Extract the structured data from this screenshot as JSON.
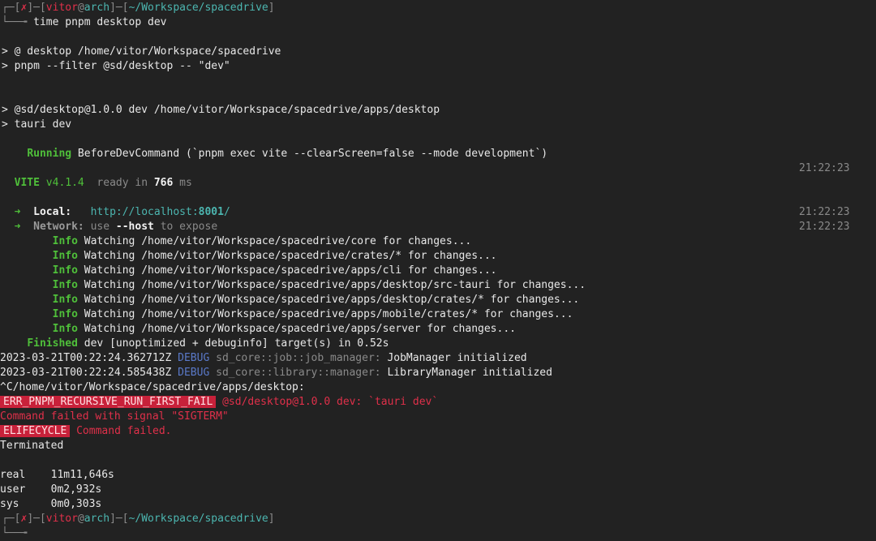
{
  "prompt": {
    "corner_top": "┌─[",
    "x_mark": "✗",
    "bracket_close": "]─[",
    "user": "vitor",
    "at": "@",
    "host": "arch",
    "bracket_close2": "]─[",
    "path": "~/Workspace/spacedrive",
    "end": "]",
    "corner_bottom": "└──╼",
    "command": "time pnpm desktop dev"
  },
  "lines": {
    "l1": "> @ desktop /home/vitor/Workspace/spacedrive",
    "l2": "> pnpm --filter @sd/desktop -- \"dev\"",
    "l3": "> @sd/desktop@1.0.0 dev /home/vitor/Workspace/spacedrive/apps/desktop",
    "l4": "> tauri dev",
    "running_label": "Running",
    "running_text": " BeforeDevCommand (`pnpm exec vite --clearScreen=false --mode development`)",
    "vite_label": "VITE",
    "vite_version": " v4.1.4",
    "vite_ready": "  ready in ",
    "vite_ms_value": "766",
    "vite_ms_unit": " ms",
    "arrow": "➜",
    "local_label": "Local:",
    "local_url_prefix": "http://localhost:",
    "local_port": "8001",
    "local_url_suffix": "/",
    "network_label": "Network:",
    "network_use": " use ",
    "network_host": "--host",
    "network_rest": " to expose",
    "info_label": "Info",
    "watch": [
      " Watching /home/vitor/Workspace/spacedrive/core for changes...",
      " Watching /home/vitor/Workspace/spacedrive/crates/* for changes...",
      " Watching /home/vitor/Workspace/spacedrive/apps/cli for changes...",
      " Watching /home/vitor/Workspace/spacedrive/apps/desktop/src-tauri for changes...",
      " Watching /home/vitor/Workspace/spacedrive/apps/desktop/crates/* for changes...",
      " Watching /home/vitor/Workspace/spacedrive/apps/mobile/crates/* for changes...",
      " Watching /home/vitor/Workspace/spacedrive/apps/server for changes..."
    ],
    "finished_label": "Finished",
    "finished_text": " dev [unoptimized + debuginfo] target(s) in 0.52s",
    "debug1_ts": "2023-03-21T00:22:24.362712Z ",
    "debug_label": "DEBUG",
    "debug1_mod": " sd_core::job::job_manager:",
    "debug1_msg": " JobManager initialized",
    "debug2_ts": "2023-03-21T00:22:24.585438Z ",
    "debug2_mod": " sd_core::library::manager:",
    "debug2_msg": " LibraryManager initialized",
    "ctrl_c": "^C/home/vitor/Workspace/spacedrive/apps/desktop:",
    "err_badge": "ERR_PNPM_RECURSIVE_RUN_FIRST_FAIL",
    "err_text": " @sd/desktop@1.0.0 dev: `tauri dev`",
    "cmd_failed": "Command failed with signal \"SIGTERM\"",
    "elifecycle_badge": "ELIFECYCLE",
    "elifecycle_text": " Command failed.",
    "terminated": "Terminated",
    "real": "real    11m11,646s",
    "user": "user    0m2,932s",
    "sys": "sys     0m0,303s"
  },
  "timestamps": {
    "t1": "21:22:23",
    "t2": "21:22:23",
    "t3": "21:22:23"
  },
  "colors": {
    "background": "#222222",
    "error_red": "#e0304a",
    "badge_bg": "#c8213a",
    "teal": "#4cb6b0",
    "green": "#4fbf3a",
    "debug_blue": "#5a79c8"
  }
}
